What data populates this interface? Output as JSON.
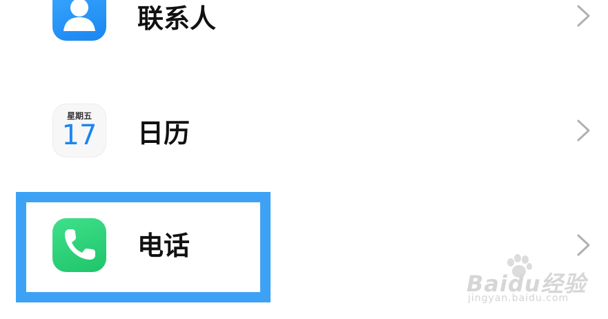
{
  "settings_list": {
    "items": [
      {
        "label": "联系人",
        "icon": "contacts-icon"
      },
      {
        "label": "日历",
        "icon": "calendar-icon",
        "calendar_weekday": "星期五",
        "calendar_day": "17"
      },
      {
        "label": "电话",
        "icon": "phone-icon"
      }
    ]
  },
  "highlight": {
    "target": "电话",
    "color": "#3da2f5"
  },
  "watermark": {
    "brand": "Baidu经验",
    "url": "jingyan.baidu.com"
  },
  "colors": {
    "contacts_icon": "#1a86f0",
    "phone_icon": "#1fc46a",
    "calendar_day": "#1a86f0",
    "chevron": "#b0b0b0"
  }
}
